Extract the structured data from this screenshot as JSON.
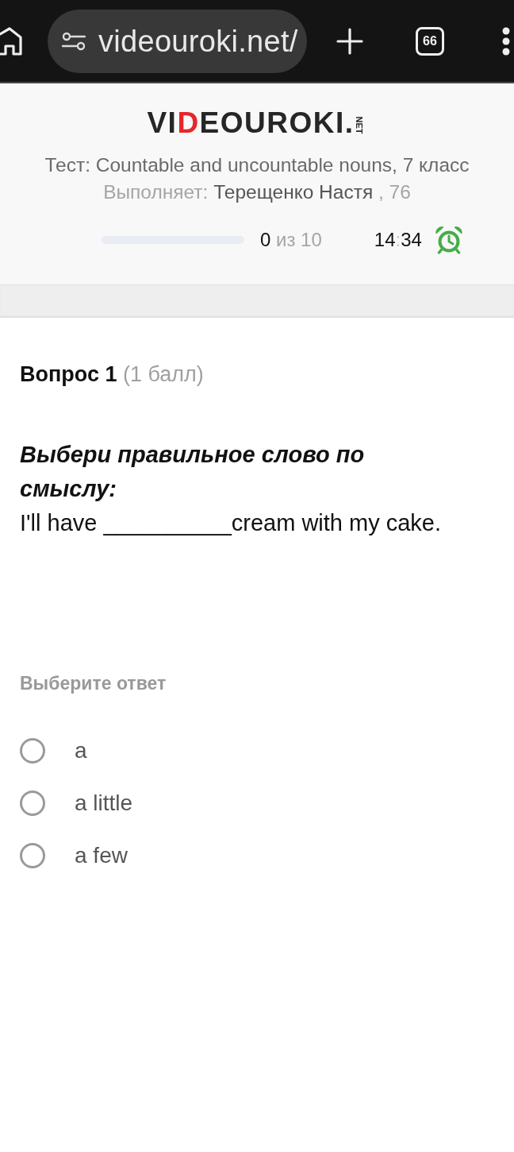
{
  "browser": {
    "url": "videouroki.net/",
    "tab_count": "66"
  },
  "header": {
    "logo": {
      "lead": "VI",
      "accent": "D",
      "rest": "EOUROKI.",
      "domain": "NET"
    },
    "test_title": "Тест: Countable and uncountable nouns, 7 класс",
    "performer": {
      "label": "Выполняет:",
      "name": "Терещенко Настя",
      "suffix": ", 76"
    },
    "progress": {
      "level": 0,
      "answered": "0",
      "of_total": "из 10"
    },
    "timer": {
      "minutes": "14",
      "separator": ":",
      "seconds": "34"
    }
  },
  "question": {
    "number": "Вопрос 1",
    "points": "(1 балл)",
    "prompt": "Выбери правильное слово по смыслу:",
    "sentence": "I'll have __________cream with my cake."
  },
  "answers": {
    "heading": "Выберите ответ",
    "options": [
      {
        "label": "a",
        "selected": false
      },
      {
        "label": "a little",
        "selected": false
      },
      {
        "label": "a few",
        "selected": false
      }
    ]
  }
}
